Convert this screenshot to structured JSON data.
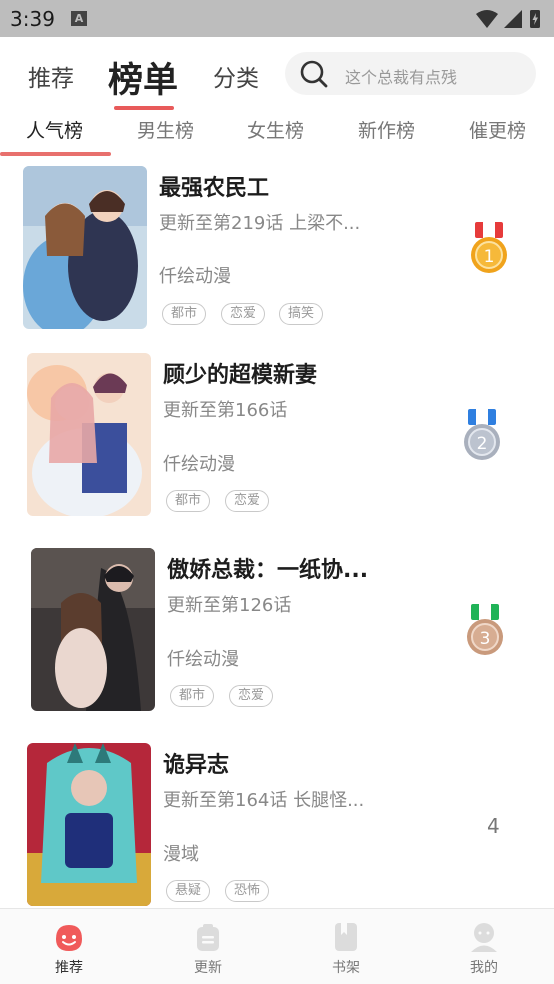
{
  "status_bar": {
    "time": "3:39",
    "notif_badge": "A"
  },
  "top_nav": {
    "tabs": [
      "推荐",
      "榜单",
      "分类"
    ],
    "active_tab": "榜单",
    "search_placeholder": "这个总裁有点残"
  },
  "rank_tabs": [
    "人气榜",
    "男生榜",
    "女生榜",
    "新作榜",
    "催更榜"
  ],
  "comics": [
    {
      "title": "最强农民工",
      "update": "更新至第219话 上梁不...",
      "author": "仟绘动漫",
      "tags": [
        "都市",
        "恋爱",
        "搞笑"
      ],
      "rank": "1",
      "medal": "gold"
    },
    {
      "title": "顾少的超模新妻",
      "update": "更新至第166话",
      "author": "仟绘动漫",
      "tags": [
        "都市",
        "恋爱"
      ],
      "rank": "2",
      "medal": "silver"
    },
    {
      "title": "傲娇总裁：一纸协...",
      "update": "更新至第126话",
      "author": "仟绘动漫",
      "tags": [
        "都市",
        "恋爱"
      ],
      "rank": "3",
      "medal": "bronze"
    },
    {
      "title": "诡异志",
      "update": "更新至第164话 长腿怪...",
      "author": "漫域",
      "tags": [
        "悬疑",
        "恐怖"
      ],
      "rank": "4",
      "medal": "none"
    }
  ],
  "bottom_nav": [
    {
      "label": "推荐",
      "icon": "smile-face-icon",
      "active": true
    },
    {
      "label": "更新",
      "icon": "bag-icon",
      "active": false
    },
    {
      "label": "书架",
      "icon": "book-icon",
      "active": false
    },
    {
      "label": "我的",
      "icon": "user-icon",
      "active": false
    }
  ],
  "colors": {
    "accent": "#e85a5a",
    "gold": "#f0a31c",
    "silver": "#a9b0bd",
    "bronze": "#c99a7c"
  }
}
